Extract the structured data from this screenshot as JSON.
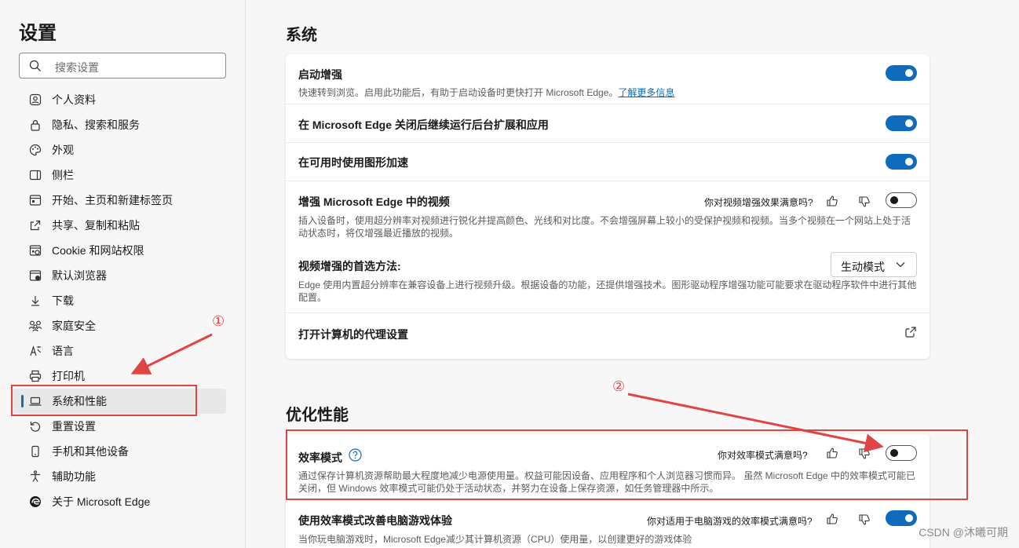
{
  "sidebar": {
    "title": "设置",
    "search_placeholder": "搜索设置",
    "items": [
      {
        "label": "个人资料",
        "icon": "profile-icon"
      },
      {
        "label": "隐私、搜索和服务",
        "icon": "lock-icon"
      },
      {
        "label": "外观",
        "icon": "palette-icon"
      },
      {
        "label": "侧栏",
        "icon": "sidebar-icon"
      },
      {
        "label": "开始、主页和新建标签页",
        "icon": "home-icon"
      },
      {
        "label": "共享、复制和粘贴",
        "icon": "share-icon"
      },
      {
        "label": "Cookie 和网站权限",
        "icon": "cookie-icon"
      },
      {
        "label": "默认浏览器",
        "icon": "browser-icon"
      },
      {
        "label": "下载",
        "icon": "download-icon"
      },
      {
        "label": "家庭安全",
        "icon": "family-icon"
      },
      {
        "label": "语言",
        "icon": "language-icon"
      },
      {
        "label": "打印机",
        "icon": "printer-icon"
      },
      {
        "label": "系统和性能",
        "icon": "laptop-icon",
        "active": true
      },
      {
        "label": "重置设置",
        "icon": "reset-icon"
      },
      {
        "label": "手机和其他设备",
        "icon": "phone-icon"
      },
      {
        "label": "辅助功能",
        "icon": "accessibility-icon"
      },
      {
        "label": "关于 Microsoft Edge",
        "icon": "edge-icon"
      }
    ]
  },
  "system": {
    "title": "系统",
    "rows": {
      "startup_boost": {
        "title": "启动增强",
        "desc": "快速转到浏览。启用此功能后，有助于启动设备时更快打开 Microsoft Edge。",
        "link": "了解更多信息",
        "on": true
      },
      "background_apps": {
        "title": "在 Microsoft Edge 关闭后继续运行后台扩展和应用",
        "on": true
      },
      "hardware_accel": {
        "title": "在可用时使用图形加速",
        "on": true
      },
      "video_enhance": {
        "title": "增强 Microsoft Edge 中的视频",
        "feedback": "你对视频增强效果满意吗?",
        "desc": "插入设备时，使用超分辨率对视频进行锐化并提高颜色、光线和对比度。不会增强屏幕上较小的受保护视频和视频。当多个视频在一个网站上处于活动状态时，将仅增强最近播放的视频。",
        "on": false,
        "method_title": "视频增强的首选方法:",
        "method_value": "生动模式",
        "method_desc": "Edge 使用内置超分辨率在兼容设备上进行视频升级。根据设备的功能，还提供增强技术。图形驱动程序增强功能可能要求在驱动程序软件中进行其他配置。"
      },
      "proxy": {
        "title": "打开计算机的代理设置"
      }
    }
  },
  "performance": {
    "title": "优化性能",
    "rows": {
      "efficiency": {
        "title": "效率模式",
        "feedback": "你对效率模式满意吗?",
        "desc": "通过保存计算机资源帮助最大程度地减少电源使用量。权益可能因设备、应用程序和个人浏览器习惯而异。 虽然 Microsoft Edge 中的效率模式可能已关闭，但 Windows 效率模式可能仍处于活动状态，并努力在设备上保存资源，如任务管理器中所示。",
        "on": false
      },
      "gaming": {
        "title": "使用效率模式改善电脑游戏体验",
        "feedback": "你对适用于电脑游戏的效率模式满意吗?",
        "desc": "当你玩电脑游戏时，Microsoft Edge减少其计算机资源（CPU）使用量，以创建更好的游戏体验",
        "on": true
      }
    }
  },
  "annotations": {
    "num1": "①",
    "num2": "②",
    "color": "#e04545"
  },
  "watermark": "CSDN @沐曦可期",
  "colors": {
    "accent": "#0f6cbd"
  }
}
